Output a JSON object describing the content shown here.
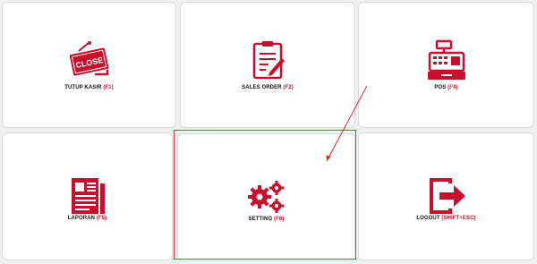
{
  "tiles": [
    {
      "name": "Tutup Kasir",
      "label": "TUTUP KASIR",
      "key": "(F1)",
      "icon": "close-sign-icon",
      "badge": "CLOSE"
    },
    {
      "name": "Sales Order",
      "label": "SALES ORDER",
      "key": "(F2)",
      "icon": "clipboard-pen-icon"
    },
    {
      "name": "POS",
      "label": "POS",
      "key": "(F4)",
      "icon": "cash-register-icon"
    },
    {
      "name": "Laporan",
      "label": "LAPORAN",
      "key": "(F5)",
      "icon": "report-document-icon"
    },
    {
      "name": "Setting",
      "label": "SETTING",
      "key": "(F6)",
      "icon": "gears-icon"
    },
    {
      "name": "Logout",
      "label": "LOGOUT",
      "key": "(SHIFT+ESC)",
      "icon": "logout-icon"
    }
  ],
  "colors": {
    "accent": "#c8102e",
    "tile_background": "#ffffff",
    "tile_border": "#dcdcdc",
    "highlight": "#e53935",
    "page_background": "#f0f0f0"
  }
}
